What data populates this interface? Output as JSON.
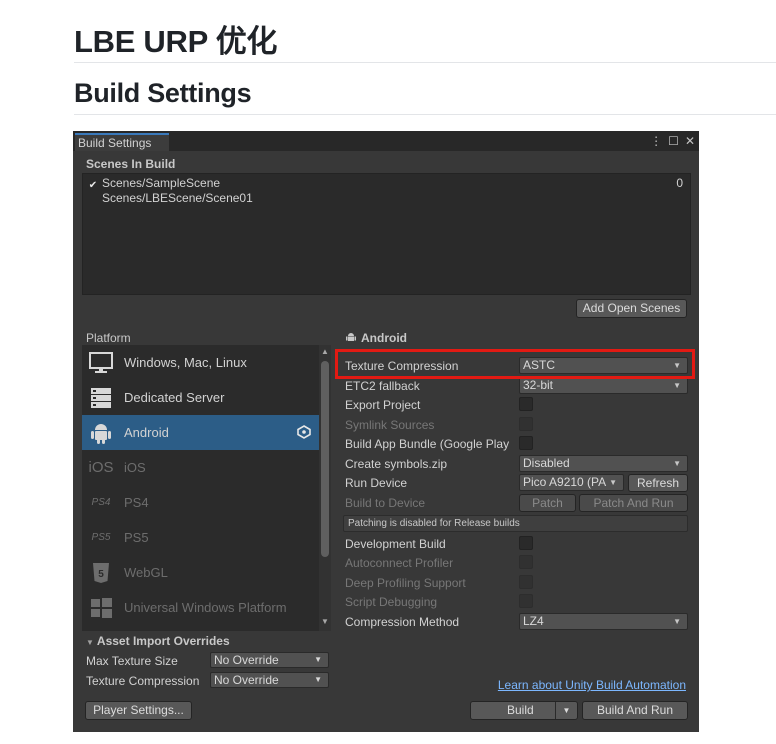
{
  "doc": {
    "title": "LBE URP 优化",
    "subtitle": "Build Settings"
  },
  "window": {
    "tab_title": "Build Settings",
    "menu_icon": "⋮",
    "maximize_icon": "☐",
    "close_icon": "✕"
  },
  "scenes": {
    "header": "Scenes In Build",
    "items": [
      {
        "name": "Scenes/SampleScene",
        "checked": true,
        "index": "0"
      },
      {
        "name": "Scenes/LBEScene/Scene01",
        "checked": false,
        "index": ""
      }
    ],
    "add_open_scenes": "Add Open Scenes"
  },
  "platform": {
    "header": "Platform",
    "items": [
      {
        "label": "Windows, Mac, Linux",
        "icon": "monitor-icon",
        "glyph": "🖵",
        "selected": false,
        "dim": false
      },
      {
        "label": "Dedicated Server",
        "icon": "server-icon",
        "glyph": "▤",
        "selected": false,
        "dim": false
      },
      {
        "label": "Android",
        "icon": "android-icon",
        "glyph": "🤖",
        "selected": true,
        "dim": false
      },
      {
        "label": "iOS",
        "icon": "ios-icon",
        "glyph": "iOS",
        "selected": false,
        "dim": true
      },
      {
        "label": "PS4",
        "icon": "ps4-icon",
        "glyph": "PS4",
        "selected": false,
        "dim": true
      },
      {
        "label": "PS5",
        "icon": "ps5-icon",
        "glyph": "PS5",
        "selected": false,
        "dim": true
      },
      {
        "label": "WebGL",
        "icon": "html5-icon",
        "glyph": "5",
        "selected": false,
        "dim": true
      },
      {
        "label": "Universal Windows Platform",
        "icon": "windows-logo-icon",
        "glyph": "⊞",
        "selected": false,
        "dim": true
      }
    ],
    "active_icon": "unity-logo-icon"
  },
  "settings": {
    "header": "Android",
    "texture_compression": {
      "label": "Texture Compression",
      "value": "ASTC"
    },
    "etc2_fallback": {
      "label": "ETC2 fallback",
      "value": "32-bit"
    },
    "export_project": "Export Project",
    "symlink_sources": "Symlink Sources",
    "build_app_bundle": "Build App Bundle (Google Play",
    "create_symbols": {
      "label": "Create symbols.zip",
      "value": "Disabled"
    },
    "run_device": {
      "label": "Run Device",
      "value": "Pico A9210 (PA",
      "refresh": "Refresh"
    },
    "build_to_device": {
      "label": "Build to Device",
      "patch": "Patch",
      "patch_and_run": "Patch And Run"
    },
    "patching_note": "Patching is disabled for Release builds",
    "development_build": "Development Build",
    "autoconnect_profiler": "Autoconnect Profiler",
    "deep_profiling": "Deep Profiling Support",
    "script_debugging": "Script Debugging",
    "compression_method": {
      "label": "Compression Method",
      "value": "LZ4"
    }
  },
  "asset_import": {
    "header": "Asset Import Overrides",
    "max_texture_size": {
      "label": "Max Texture Size",
      "value": "No Override"
    },
    "texture_compression": {
      "label": "Texture Compression",
      "value": "No Override"
    }
  },
  "footer": {
    "learn_link": "Learn about Unity Build Automation",
    "player_settings": "Player Settings...",
    "build": "Build",
    "build_and_run": "Build And Run"
  },
  "colors": {
    "highlight_box": "#e21a13",
    "selection": "#2c5d87",
    "link": "#7cb7ff"
  }
}
